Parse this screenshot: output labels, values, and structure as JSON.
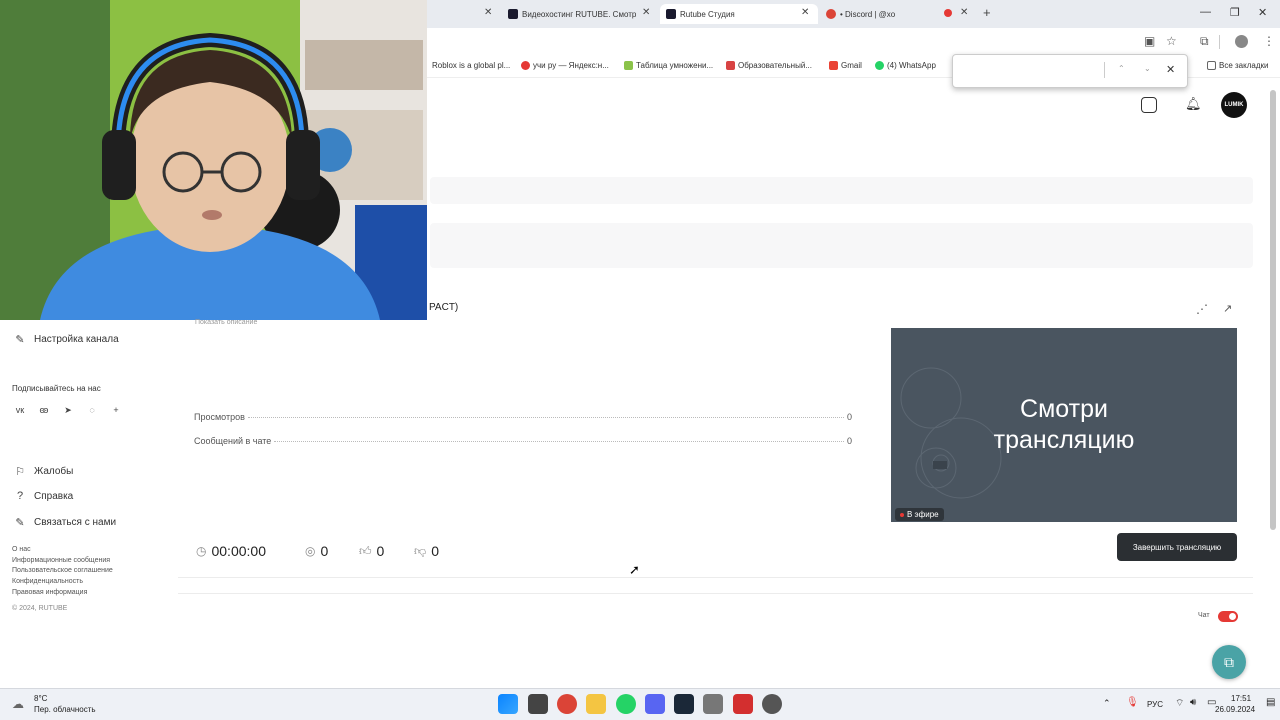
{
  "browser": {
    "tabs": [
      {
        "label": "Видеохостинг RUTUBE. Смотр",
        "active": false
      },
      {
        "label": "Rutube Студия",
        "active": true
      },
      {
        "label": "• Discord | @хо",
        "active": false
      }
    ],
    "new_tab": "+",
    "bookmarks": [
      "Roblox is a global pl...",
      "учи ру — Яндекс:н...",
      "Таблица умножени...",
      "Образовательный...",
      "Gmail",
      "(4) WhatsApp"
    ],
    "bookmarks_folder": "Все закладки"
  },
  "header": {
    "avatar_label": "LUMIK"
  },
  "stream": {
    "title_fragment": "PACT)",
    "show_description": "Показать описание",
    "stats": [
      {
        "label": "Просмотров",
        "value": "0"
      },
      {
        "label": "Сообщений в чате",
        "value": "0"
      }
    ],
    "preview_text_line1": "Смотри",
    "preview_text_line2": "трансляцию",
    "live_label": "В эфире",
    "end_button": "Завершить трансляцию",
    "timer": "00:00:00",
    "viewers": "0",
    "likes": "0",
    "dislikes": "0",
    "chat_label": "Чат",
    "chat_enabled": true
  },
  "sidebar": {
    "channel_settings": "Настройка канала",
    "subscribe_heading": "Подписывайтесь на нас",
    "socials": [
      "vk-icon",
      "odnoklassniki-icon",
      "telegram-icon",
      "viber-icon",
      "plus-icon"
    ],
    "complaints": "Жалобы",
    "help": "Справка",
    "contact": "Связаться с нами",
    "footer_links": [
      "О нас",
      "Информационные сообщения",
      "Пользовательское соглашение",
      "Конфиденциальность",
      "Правовая информация"
    ],
    "copyright": "© 2024, RUTUBE"
  },
  "taskbar": {
    "weather_temp": "8°C",
    "weather_desc": "Пер. облачность",
    "language": "РУС",
    "time": "17:51",
    "date": "26.09.2024"
  },
  "colors": {
    "accent_red": "#e53935",
    "dark_button": "#2b2f33",
    "float_teal": "#4aa3a6"
  }
}
